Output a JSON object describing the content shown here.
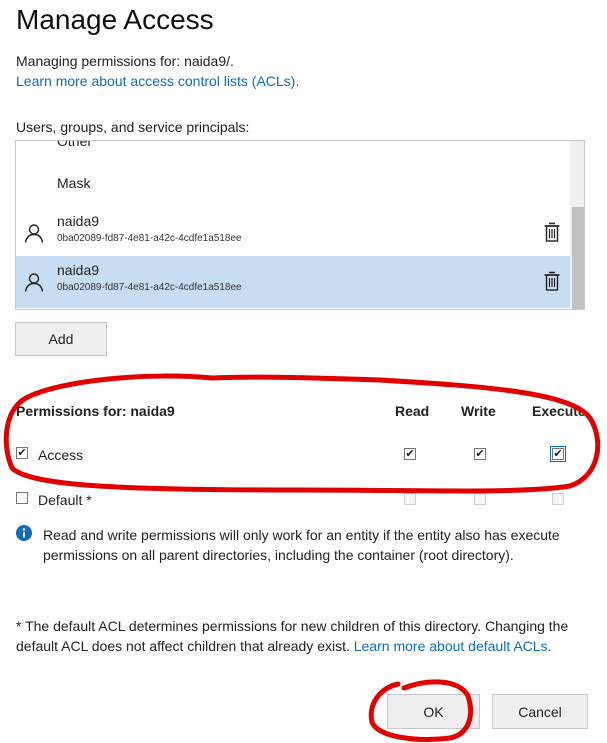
{
  "header": {
    "title": "Manage Access",
    "managing_text": "Managing permissions for: naida9/.",
    "acl_link": "Learn more about access control lists (ACLs)."
  },
  "principals": {
    "label": "Users, groups, and service principals:",
    "items": [
      {
        "name": "Other"
      },
      {
        "name": "Mask"
      },
      {
        "name": "naida9",
        "id": "0ba02089-fd87-4e81-a42c-4cdfe1a518ee",
        "selected": false
      },
      {
        "name": "naida9",
        "id": "0ba02089-fd87-4e81-a42c-4cdfe1a518ee",
        "selected": true
      }
    ],
    "add_label": "Add"
  },
  "permissions": {
    "header": "Permissions for: naida9",
    "columns": [
      "Read",
      "Write",
      "Execute"
    ],
    "rows": [
      {
        "label": "Access",
        "checked": true,
        "read": true,
        "write": true,
        "execute": true
      },
      {
        "label": "Default *",
        "checked": false,
        "read": false,
        "write": false,
        "execute": false
      }
    ]
  },
  "info": {
    "text": "Read and write permissions will only work for an entity if the entity also has execute permissions on all parent directories, including the container (root directory)."
  },
  "default_note": {
    "text": "* The default ACL determines permissions for new children of this directory. Changing the default ACL does not affect children that already exist. ",
    "link": "Learn more about default ACLs."
  },
  "buttons": {
    "ok": "OK",
    "cancel": "Cancel"
  },
  "colors": {
    "link": "#0f6cbd",
    "selected_row": "#c7ddf2",
    "annotation": "#e00000",
    "info_icon": "#0f6cbd"
  },
  "icons": [
    "user-icon",
    "trash-icon",
    "info-icon",
    "check-icon"
  ]
}
